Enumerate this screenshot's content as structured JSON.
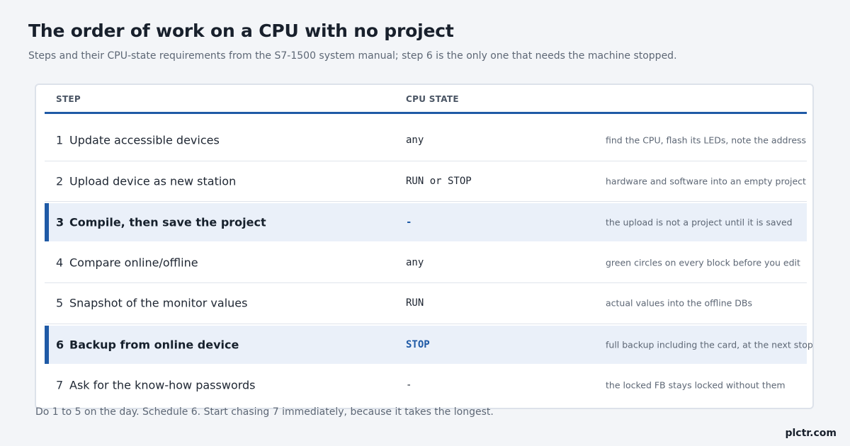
{
  "header": {
    "title": "The order of work on a CPU with no project",
    "subtitle": "Steps and their CPU-state requirements from the S7-1500 system manual; step 6 is the only one that needs the machine stopped."
  },
  "table": {
    "columns": [
      "STEP",
      "CPU STATE"
    ],
    "rows": [
      {
        "num": "1",
        "step": "Update accessible devices",
        "state": "any",
        "note": "find the CPU, flash its LEDs, note the address",
        "highlight": false
      },
      {
        "num": "2",
        "step": "Upload device as new station",
        "state": "RUN or STOP",
        "note": "hardware and software into an empty project",
        "highlight": false
      },
      {
        "num": "3",
        "step": "Compile, then save the project",
        "state": "-",
        "note": "the upload is not a project until it is saved",
        "highlight": true
      },
      {
        "num": "4",
        "step": "Compare online/offline",
        "state": "any",
        "note": "green circles on every block before you edit",
        "highlight": false
      },
      {
        "num": "5",
        "step": "Snapshot of the monitor values",
        "state": "RUN",
        "note": "actual values into the offline DBs",
        "highlight": false
      },
      {
        "num": "6",
        "step": "Backup from online device",
        "state": "STOP",
        "note": "full backup including the card, at the next stop",
        "highlight": true
      },
      {
        "num": "7",
        "step": "Ask for the know-how passwords",
        "state": "-",
        "note": "the locked FB stays locked without them",
        "highlight": false
      }
    ]
  },
  "footer": {
    "note": "Do 1 to 5 on the day. Schedule 6. Start chasing 7 immediately, because it takes the longest.",
    "brand": "plctr.com"
  },
  "colors": {
    "accent": "#1f5aa6",
    "highlight_bg": "#eaf0f9",
    "background": "#f3f5f8"
  }
}
